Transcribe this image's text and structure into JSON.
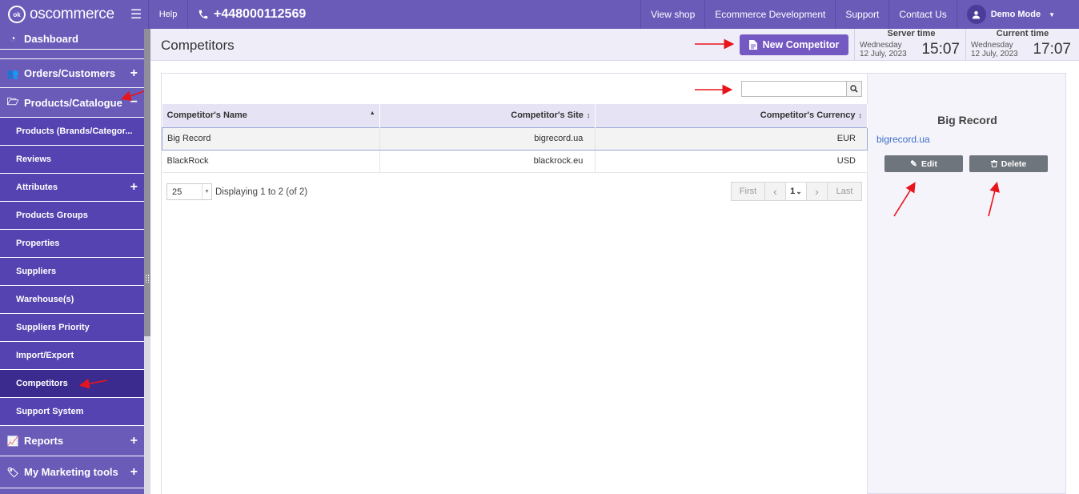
{
  "topbar": {
    "logo_text": "oscommerce",
    "logo_mark": "ok",
    "help": "Help",
    "phone": "+448000112569",
    "links": [
      "View shop",
      "Ecommerce Development",
      "Support",
      "Contact Us"
    ],
    "user": "Demo Mode"
  },
  "sidebar": {
    "dashboard": "Dashboard",
    "orders": "Orders/Customers",
    "products": "Products/Catalogue",
    "subitems": [
      "Products (Brands/Categor...",
      "Reviews",
      "Attributes",
      "Products Groups",
      "Properties",
      "Suppliers",
      "Warehouse(s)",
      "Suppliers Priority",
      "Import/Export",
      "Competitors",
      "Support System"
    ],
    "reports": "Reports",
    "marketing": "My Marketing tools"
  },
  "header": {
    "title": "Competitors",
    "new_button": "New Competitor",
    "server_time": {
      "label": "Server time",
      "day": "Wednesday",
      "date": "12 July, 2023",
      "time": "15:07"
    },
    "current_time": {
      "label": "Current time",
      "day": "Wednesday",
      "date": "12 July, 2023",
      "time": "17:07"
    }
  },
  "table": {
    "columns": [
      "Competitor's Name",
      "Competitor's Site",
      "Competitor's Currency"
    ],
    "rows": [
      {
        "name": "Big Record",
        "site": "bigrecord.ua",
        "currency": "EUR"
      },
      {
        "name": "BlackRock",
        "site": "blackrock.eu",
        "currency": "USD"
      }
    ],
    "per_page": "25",
    "displaying": "Displaying 1 to 2 (of 2)",
    "pager": {
      "first": "First",
      "page": "1",
      "last": "Last"
    }
  },
  "detail": {
    "title": "Big Record",
    "site": "bigrecord.ua",
    "edit": "Edit",
    "delete": "Delete"
  },
  "colors": {
    "brand": "#6a5bb9",
    "submenu": "#5443b0",
    "active": "#3b2b8f",
    "button": "#7559c2",
    "annotation": "#e8141c"
  }
}
